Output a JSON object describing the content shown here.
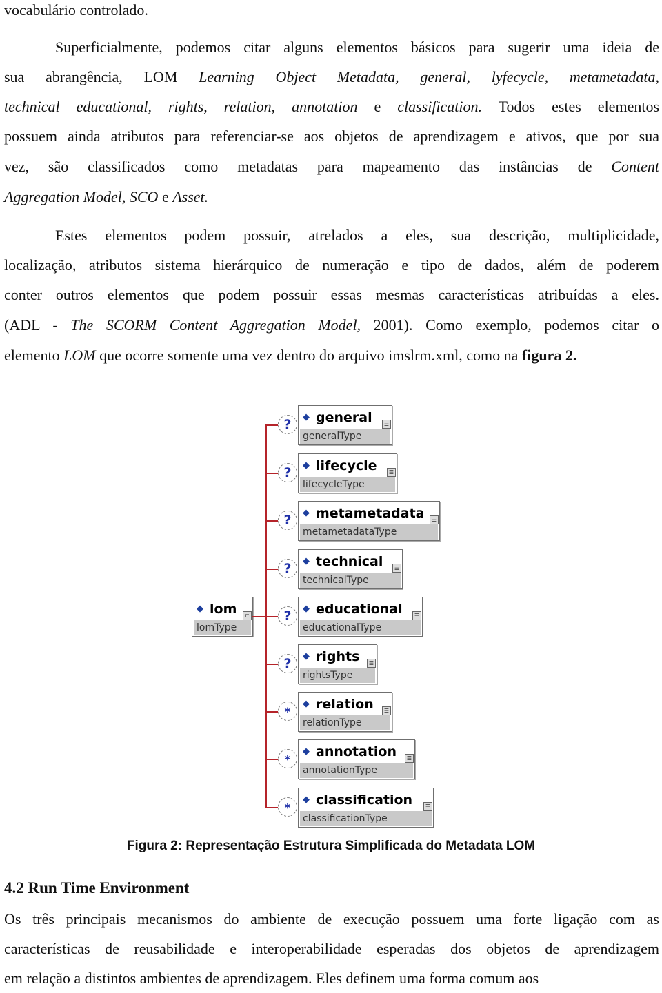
{
  "page": {
    "top_line": "vocabulário controlado.",
    "para1": [
      {
        "segments": [
          {
            "t": "Superficialmente, podemos citar alguns elementos básicos para sugerir uma ideia de"
          }
        ]
      },
      {
        "segments": [
          {
            "t": "sua abrangência, LOM "
          },
          {
            "t": "Learning Object Metadata, general, lyfecycle, metametadata,",
            "i": true
          }
        ]
      },
      {
        "segments": [
          {
            "t": "technical educational, rights, relation, annotation",
            "i": true
          },
          {
            "t": " e "
          },
          {
            "t": "classification.",
            "i": true
          },
          {
            "t": " Todos estes elementos"
          }
        ]
      },
      {
        "segments": [
          {
            "t": "possuem ainda atributos para referenciar-se aos objetos de aprendizagem e ativos, que por sua"
          }
        ]
      },
      {
        "segments": [
          {
            "t": "vez, são classificados como metadatas para mapeamento das instâncias de "
          },
          {
            "t": "Content",
            "i": true
          }
        ]
      },
      {
        "segments": [
          {
            "t": "Aggregation Model, SCO",
            "i": true
          },
          {
            "t": " e "
          },
          {
            "t": "Asset.",
            "i": true
          }
        ]
      }
    ],
    "para2": [
      {
        "segments": [
          {
            "t": "Estes elementos podem possuir, atrelados a eles, sua descrição, multiplicidade,"
          }
        ]
      },
      {
        "segments": [
          {
            "t": "localização, atributos sistema hierárquico de numeração e tipo de dados, além de poderem"
          }
        ]
      },
      {
        "segments": [
          {
            "t": "conter outros elementos que podem possuir essas mesmas características atribuídas a eles."
          }
        ]
      },
      {
        "segments": [
          {
            "t": "(ADL - "
          },
          {
            "t": "The SCORM Content Aggregation Model,",
            "i": true
          },
          {
            "t": " 2001). Como exemplo, podemos citar o"
          }
        ]
      },
      {
        "segments": [
          {
            "t": "elemento "
          },
          {
            "t": "LOM",
            "i": true
          },
          {
            "t": " que ocorre somente uma vez dentro do arquivo imslrm.xml, como na "
          },
          {
            "t": "figura 2.",
            "b": true
          }
        ]
      }
    ],
    "figure": {
      "root": {
        "name": "lom",
        "type": "lomType"
      },
      "children": [
        {
          "name": "general",
          "type": "generalType",
          "cardinality": "?"
        },
        {
          "name": "lifecycle",
          "type": "lifecycleType",
          "cardinality": "?"
        },
        {
          "name": "metametadata",
          "type": "metametadataType",
          "cardinality": "?"
        },
        {
          "name": "technical",
          "type": "technicalType",
          "cardinality": "?"
        },
        {
          "name": "educational",
          "type": "educationalType",
          "cardinality": "?"
        },
        {
          "name": "rights",
          "type": "rightsType",
          "cardinality": "?"
        },
        {
          "name": "relation",
          "type": "relationType",
          "cardinality": "*"
        },
        {
          "name": "annotation",
          "type": "annotationType",
          "cardinality": "*"
        },
        {
          "name": "classification",
          "type": "classificationType",
          "cardinality": "*"
        }
      ],
      "caption": "Figura 2: Representação Estrutura Simplificada do Metadata LOM",
      "colors": {
        "connector": "#b5242a",
        "diamond": "#1d3f9e",
        "type_bg": "#c9c9c9"
      }
    },
    "section_heading": "4.2 Run Time Environment",
    "para3": [
      {
        "segments": [
          {
            "t": "Os três principais mecanismos do ambiente de execução possuem uma forte ligação com as"
          }
        ]
      },
      {
        "segments": [
          {
            "t": "características de reusabilidade e interoperabilidade esperadas dos objetos de aprendizagem"
          }
        ]
      },
      {
        "segments": [
          {
            "t": "em relação a distintos ambientes de aprendizagem. Eles definem uma forma comum aos"
          }
        ]
      }
    ]
  }
}
